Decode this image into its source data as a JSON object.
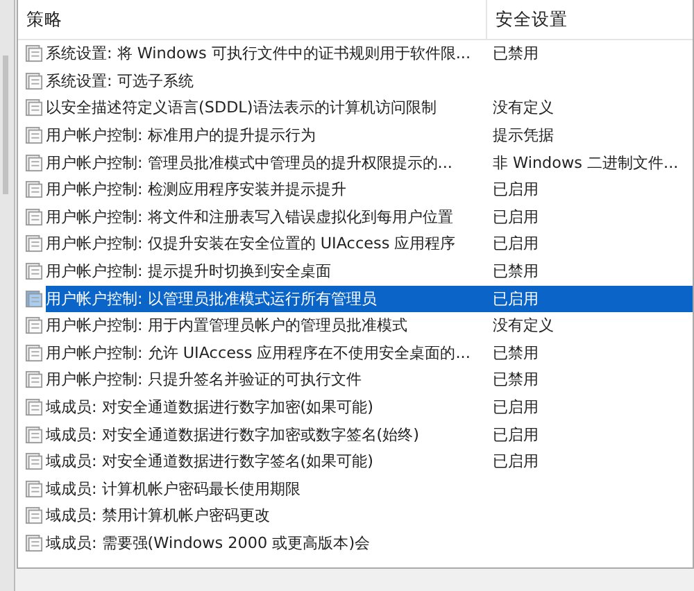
{
  "table": {
    "columns": [
      "策略",
      "安全设置"
    ],
    "rows": [
      {
        "policy": "系统设置: 将 Windows 可执行文件中的证书规则用于软件限...",
        "setting": "已禁用",
        "selected": false
      },
      {
        "policy": "系统设置: 可选子系统",
        "selected": false
      },
      {
        "policy": "以安全描述符定义语言(SDDL)语法表示的计算机访问限制",
        "setting": "没有定义",
        "selected": false
      },
      {
        "policy": "用户帐户控制: 标准用户的提升提示行为",
        "setting": "提示凭据",
        "selected": false
      },
      {
        "policy": "用户帐户控制: 管理员批准模式中管理员的提升权限提示的...",
        "setting": "非 Windows 二进制文件...",
        "selected": false
      },
      {
        "policy": "用户帐户控制: 检测应用程序安装并提示提升",
        "setting": "已启用",
        "selected": false
      },
      {
        "policy": "用户帐户控制: 将文件和注册表写入错误虚拟化到每用户位置",
        "setting": "已启用",
        "selected": false
      },
      {
        "policy": "用户帐户控制: 仅提升安装在安全位置的 UIAccess 应用程序",
        "setting": "已启用",
        "selected": false
      },
      {
        "policy": "用户帐户控制: 提示提升时切换到安全桌面",
        "setting": "已禁用",
        "selected": false
      },
      {
        "policy": "用户帐户控制: 以管理员批准模式运行所有管理员",
        "setting": "已启用",
        "selected": true
      },
      {
        "policy": "用户帐户控制: 用于内置管理员帐户的管理员批准模式",
        "setting": "没有定义",
        "selected": false
      },
      {
        "policy": "用户帐户控制: 允许 UIAccess 应用程序在不使用安全桌面的...",
        "setting": "已禁用",
        "selected": false
      },
      {
        "policy": "用户帐户控制: 只提升签名并验证的可执行文件",
        "setting": "已禁用",
        "selected": false
      },
      {
        "policy": "域成员: 对安全通道数据进行数字加密(如果可能)",
        "setting": "已启用",
        "selected": false
      },
      {
        "policy": "域成员: 对安全通道数据进行数字加密或数字签名(始终)",
        "setting": "已启用",
        "selected": false
      },
      {
        "policy": "域成员: 对安全通道数据进行数字签名(如果可能)",
        "setting": "已启用",
        "selected": false
      },
      {
        "policy": "域成员: 计算机帐户密码最长使用期限",
        "selected": false
      },
      {
        "policy": "域成员: 禁用计算机帐户密码更改",
        "selected": false
      },
      {
        "policy": "域成员: 需要强(Windows 2000 或更高版本)会",
        "selected": false
      }
    ]
  }
}
